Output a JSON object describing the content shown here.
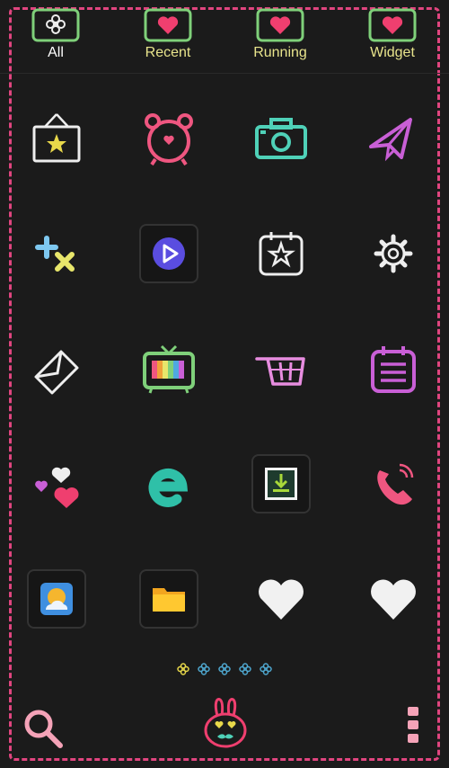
{
  "tabs": [
    {
      "label": "All",
      "icon": "flower-icon",
      "active": true
    },
    {
      "label": "Recent",
      "icon": "heart-icon",
      "active": false
    },
    {
      "label": "Running",
      "icon": "heart-icon",
      "active": false
    },
    {
      "label": "Widget",
      "icon": "heart-icon",
      "active": false
    }
  ],
  "apps": [
    {
      "icon": "star-frame-icon"
    },
    {
      "icon": "alarm-clock-icon"
    },
    {
      "icon": "camera-icon"
    },
    {
      "icon": "paper-plane-icon"
    },
    {
      "icon": "calculator-icon"
    },
    {
      "icon": "video-player-icon"
    },
    {
      "icon": "star-calendar-icon"
    },
    {
      "icon": "gear-icon"
    },
    {
      "icon": "email-envelope-icon"
    },
    {
      "icon": "tv-icon"
    },
    {
      "icon": "shopping-cart-icon"
    },
    {
      "icon": "notes-icon"
    },
    {
      "icon": "hearts-icon"
    },
    {
      "icon": "browser-e-icon"
    },
    {
      "icon": "download-icon"
    },
    {
      "icon": "phone-icon"
    },
    {
      "icon": "weather-icon"
    },
    {
      "icon": "folder-icon"
    },
    {
      "icon": "white-heart-icon"
    },
    {
      "icon": "white-heart-icon"
    }
  ],
  "pager": {
    "pages": 5,
    "current": 1
  },
  "dock": {
    "search_icon": "search-icon",
    "home_icon": "bunny-home-icon",
    "menu_icon": "more-menu-icon"
  },
  "colors": {
    "background": "#1b1b1b",
    "frame_dash": "#e0457f",
    "tab_label": "#e8e48c",
    "tab_label_active": "#ffffff",
    "chalk_pink": "#ef5680",
    "chalk_teal": "#4fd1b8",
    "chalk_purple": "#c95fd6",
    "chalk_green": "#7fd07a",
    "chalk_yellow": "#e8e66b",
    "chalk_white": "#eeeeee"
  }
}
